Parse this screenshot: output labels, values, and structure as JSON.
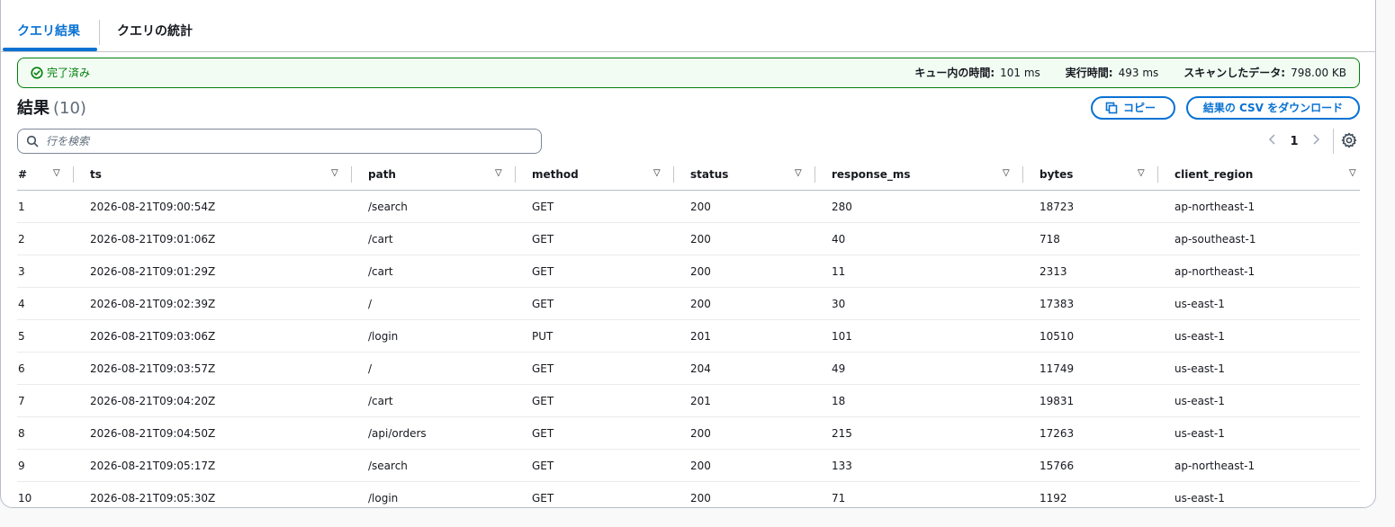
{
  "tabs": [
    {
      "label": "クエリ結果"
    },
    {
      "label": "クエリの統計"
    }
  ],
  "status": {
    "text": "完了済み",
    "stats": [
      {
        "label": "キュー内の時間:",
        "value": "101 ms"
      },
      {
        "label": "実行時間:",
        "value": "493 ms"
      },
      {
        "label": "スキャンしたデータ:",
        "value": "798.00 KB"
      }
    ]
  },
  "results": {
    "title": "結果",
    "count": "(10)",
    "copy_label": "コピー",
    "download_label": "結果の CSV をダウンロード",
    "search_placeholder": "行を検索",
    "page": "1"
  },
  "table": {
    "columns": [
      "#",
      "ts",
      "path",
      "method",
      "status",
      "response_ms",
      "bytes",
      "client_region"
    ],
    "rows": [
      [
        "1",
        "2026-08-21T09:00:54Z",
        "/search",
        "GET",
        "200",
        "280",
        "18723",
        "ap-northeast-1"
      ],
      [
        "2",
        "2026-08-21T09:01:06Z",
        "/cart",
        "GET",
        "200",
        "40",
        "718",
        "ap-southeast-1"
      ],
      [
        "3",
        "2026-08-21T09:01:29Z",
        "/cart",
        "GET",
        "200",
        "11",
        "2313",
        "ap-northeast-1"
      ],
      [
        "4",
        "2026-08-21T09:02:39Z",
        "/",
        "GET",
        "200",
        "30",
        "17383",
        "us-east-1"
      ],
      [
        "5",
        "2026-08-21T09:03:06Z",
        "/login",
        "PUT",
        "201",
        "101",
        "10510",
        "us-east-1"
      ],
      [
        "6",
        "2026-08-21T09:03:57Z",
        "/",
        "GET",
        "204",
        "49",
        "11749",
        "us-east-1"
      ],
      [
        "7",
        "2026-08-21T09:04:20Z",
        "/cart",
        "GET",
        "201",
        "18",
        "19831",
        "us-east-1"
      ],
      [
        "8",
        "2026-08-21T09:04:50Z",
        "/api/orders",
        "GET",
        "200",
        "215",
        "17263",
        "us-east-1"
      ],
      [
        "9",
        "2026-08-21T09:05:17Z",
        "/search",
        "GET",
        "200",
        "133",
        "15766",
        "ap-northeast-1"
      ],
      [
        "10",
        "2026-08-21T09:05:30Z",
        "/login",
        "GET",
        "200",
        "71",
        "1192",
        "us-east-1"
      ]
    ]
  },
  "colors": {
    "accent": "#0972d3",
    "success": "#037f0c",
    "success_bg": "#f2fcf3"
  }
}
